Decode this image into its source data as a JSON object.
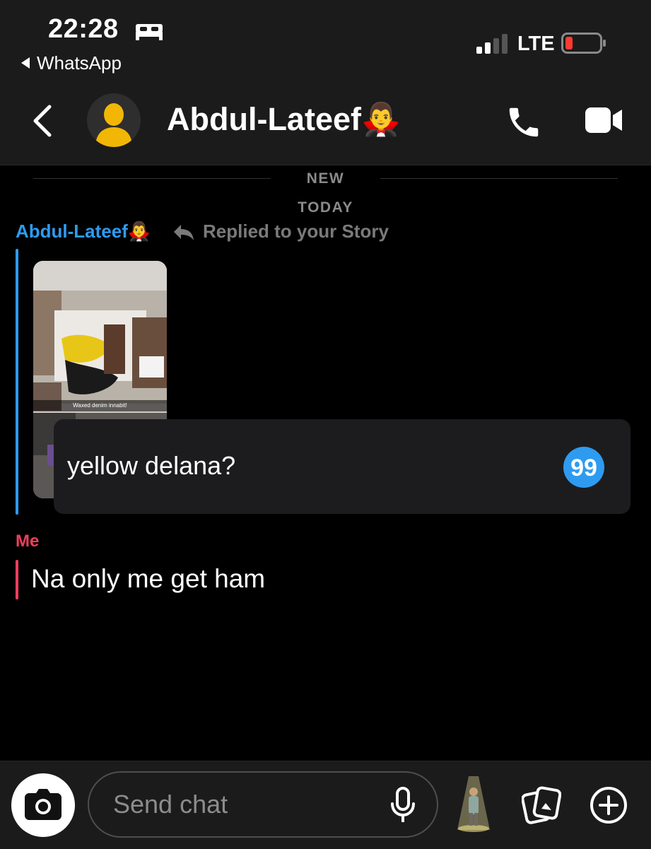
{
  "status_bar": {
    "time": "22:28",
    "back_app": "WhatsApp",
    "network": "LTE",
    "battery_color": "#ff3b30"
  },
  "header": {
    "contact_name": "Abdul-Lateef🧛‍♂️",
    "icons": [
      "back-icon",
      "avatar",
      "phone-icon",
      "video-camera-icon"
    ]
  },
  "chat": {
    "new_label": "NEW",
    "today_label": "TODAY",
    "sender_name": "Abdul-Lateef🧛‍♂️",
    "sender_color": "#2e9bf0",
    "replied_label": "Replied to your Story",
    "story_caption": "Waxed denim innabit!",
    "reply_message": "yellow delana?",
    "me_label": "Me",
    "me_color": "#ef3e5c",
    "my_message": "Na only me get ham"
  },
  "composer": {
    "placeholder": "Send chat",
    "icons": [
      "camera-icon",
      "microphone-icon",
      "bitmoji-icon",
      "memories-icon",
      "plus-icon"
    ]
  }
}
